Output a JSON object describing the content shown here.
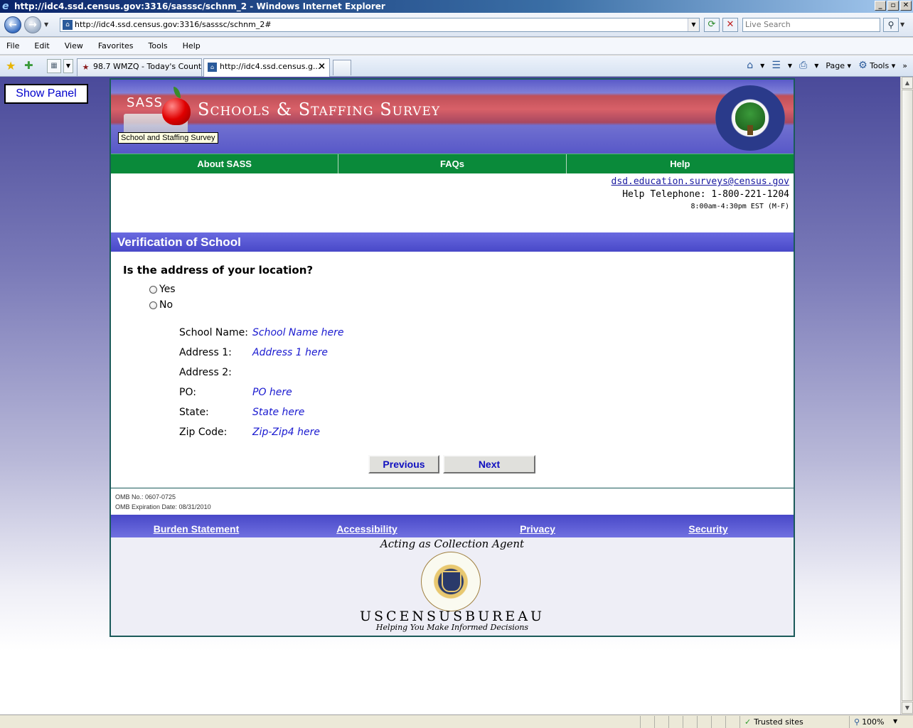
{
  "window": {
    "title": "http://idc4.ssd.census.gov:3316/sasssc/schnm_2 - Windows Internet Explorer",
    "buttons": [
      "_",
      "▫",
      "✕"
    ]
  },
  "browser": {
    "url": "http://idc4.ssd.census.gov:3316/sasssc/schnm_2#",
    "search_placeholder": "Live Search",
    "menu": [
      "File",
      "Edit",
      "View",
      "Favorites",
      "Tools",
      "Help"
    ],
    "tabs": [
      {
        "label": "98.7 WMZQ - Today's Count..."
      },
      {
        "label": "http://idc4.ssd.census.g..."
      }
    ],
    "commands": {
      "page": "Page",
      "tools": "Tools"
    }
  },
  "side": {
    "show_panel": "Show Panel"
  },
  "banner": {
    "sass": "SASS",
    "title": "Schools & Staffing Survey",
    "tooltip": "School and Staffing Survey"
  },
  "nav": [
    "About SASS",
    "FAQs",
    "Help"
  ],
  "contact": {
    "email": "dsd.education.surveys@census.gov",
    "telephone": "Help Telephone: 1-800-221-1204",
    "hours": "8:00am-4:30pm EST (M-F)"
  },
  "section": {
    "title": "Verification of School"
  },
  "question": {
    "text": "Is the address of your location?",
    "options": [
      "Yes",
      "No"
    ]
  },
  "school": [
    {
      "label": "School Name:",
      "value": "School Name here"
    },
    {
      "label": "Address 1:",
      "value": "Address 1 here"
    },
    {
      "label": "Address 2:",
      "value": ""
    },
    {
      "label": "PO:",
      "value": "PO here"
    },
    {
      "label": "State:",
      "value": "State here"
    },
    {
      "label": "Zip Code:",
      "value": "Zip-Zip4 here"
    }
  ],
  "buttons": {
    "previous": "Previous",
    "next": "Next"
  },
  "omb": {
    "number": "OMB No.: 0607-0725",
    "expiration": "OMB Expiration Date: 08/31/2010"
  },
  "footer": {
    "links": [
      "Burden Statement",
      "Accessibility",
      "Privacy",
      "Security"
    ],
    "acting": "Acting as Collection Agent",
    "bureau": "USCENSUSBUREAU",
    "tagline": "Helping You Make Informed Decisions"
  },
  "status": {
    "zone": "Trusted sites",
    "zoom": "100%"
  }
}
